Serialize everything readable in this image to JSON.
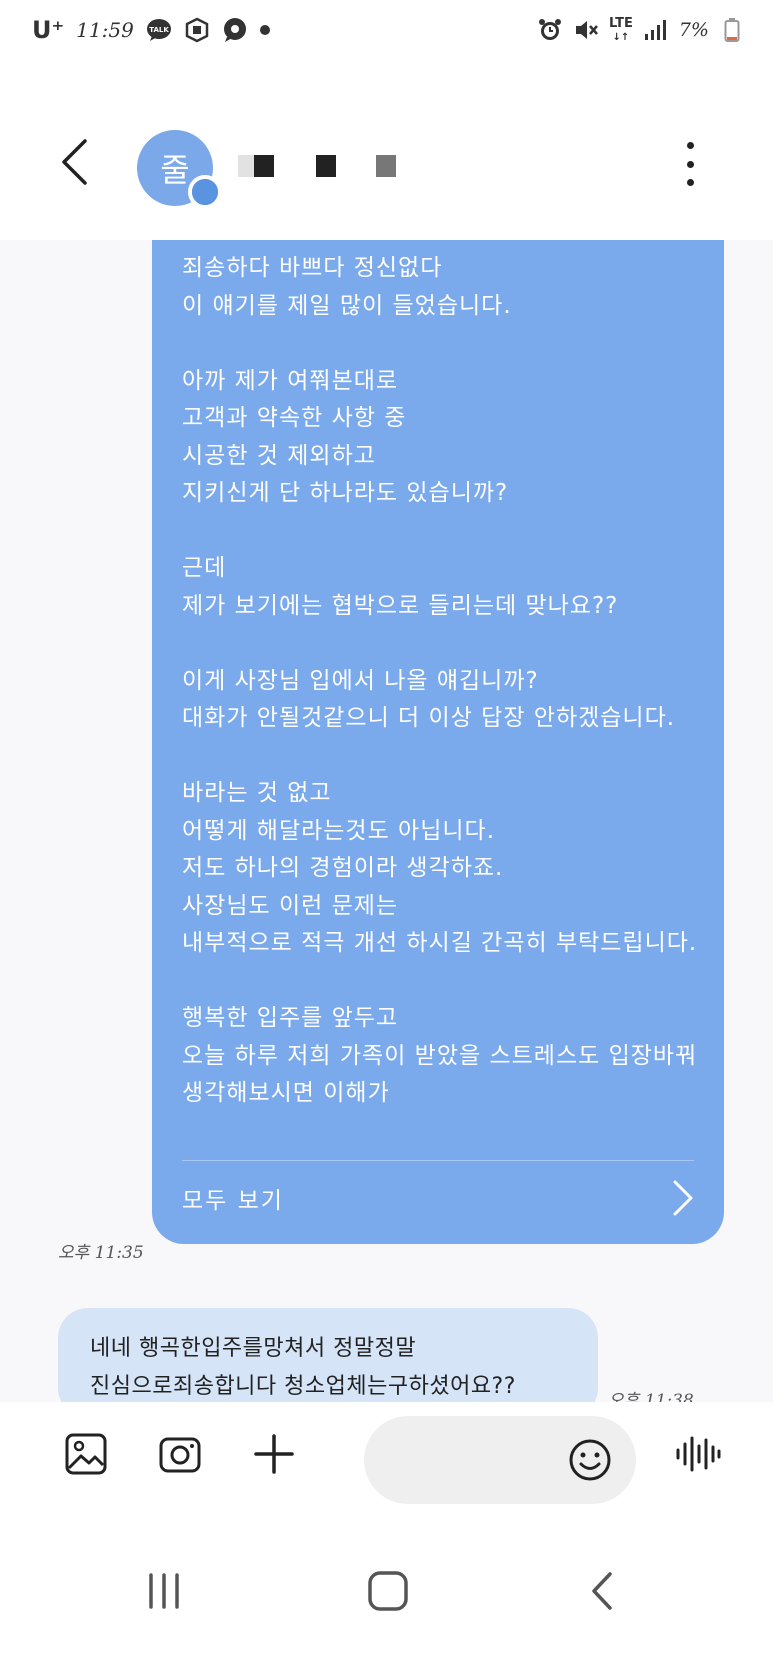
{
  "status_bar": {
    "carrier": "U⁺",
    "time": "11:59",
    "network": "LTE",
    "battery": "7%",
    "icons": [
      "talk-icon",
      "app-icon",
      "chat-icon",
      "dot-icon",
      "alarm-icon",
      "mute-icon",
      "lte-icon",
      "signal-icon",
      "battery-icon"
    ]
  },
  "header": {
    "avatar_initial": "줄",
    "back_icon": "chevron-left-icon",
    "more_icon": "more-vertical-icon"
  },
  "messages": [
    {
      "direction": "incoming",
      "text": "죄송하다 바쁘다 정신없다\n이 얘기를 제일 많이 들었습니다.\n\n아까 제가 여쭤본대로\n고객과 약속한 사항 중\n시공한 것 제외하고\n지키신게 단 하나라도 있습니까?\n\n근데\n제가 보기에는 협박으로 들리는데 맞나요??\n\n이게 사장님 입에서 나올 얘깁니까?\n대화가 안될것같으니 더 이상 답장 안하겠습니다.\n\n바라는 것 없고\n어떻게 해달라는것도 아닙니다.\n저도 하나의 경험이라 생각하죠.\n사장님도 이런 문제는\n내부적으로 적극 개선 하시길 간곡히 부탁드립니다.\n\n행복한 입주를 앞두고\n오늘 하루 저희 가족이 받았을 스트레스도 입장바꿔\n생각해보시면 이해가",
      "view_all_label": "모두 보기",
      "time": "오후 11:35"
    },
    {
      "direction": "outgoing",
      "text": "네네 행곡한입주를망쳐서 정말정말\n진심으로죄송합니다 청소업체는구하셨어요??",
      "time": "오후 11:38"
    }
  ],
  "input_bar": {
    "placeholder": "",
    "tools": [
      "gallery-icon",
      "camera-icon",
      "plus-icon",
      "emoji-icon",
      "voice-icon"
    ]
  },
  "nav_bar": {
    "buttons": [
      "recent-apps-icon",
      "home-icon",
      "back-icon"
    ]
  },
  "colors": {
    "incoming_bubble": "#7aa9ec",
    "outgoing_bubble": "#d5e4f7",
    "avatar": "#7ba8e8",
    "chat_background": "#f8f8fa"
  }
}
